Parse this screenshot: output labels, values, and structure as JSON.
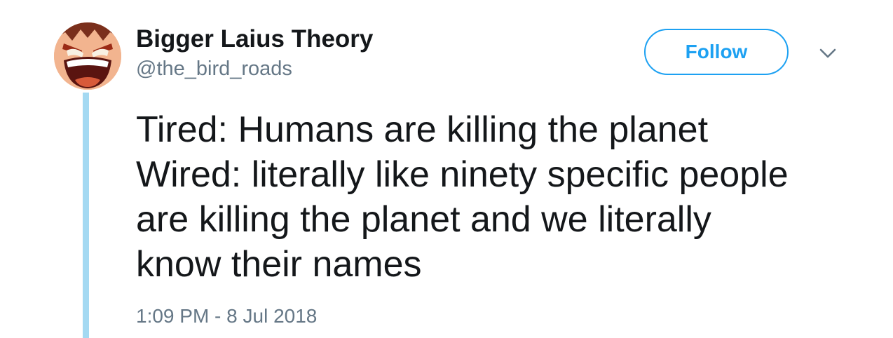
{
  "tweet": {
    "author": {
      "display_name": "Bigger Laius Theory",
      "handle": "@the_bird_roads",
      "avatar": "shouting-cartoon-face-avatar"
    },
    "follow_label": "Follow",
    "menu_icon": "chevron-down-icon",
    "text_lines": [
      "Tired: Humans are killing the planet",
      "Wired: literally like ninety specific people",
      "are killing the planet and we literally",
      "know their names"
    ],
    "timestamp": "1:09 PM - 8 Jul 2018"
  },
  "colors": {
    "accent": "#1da1f2",
    "thread_line": "#a4d9f2",
    "text_primary": "#14171a",
    "text_secondary": "#657786"
  }
}
